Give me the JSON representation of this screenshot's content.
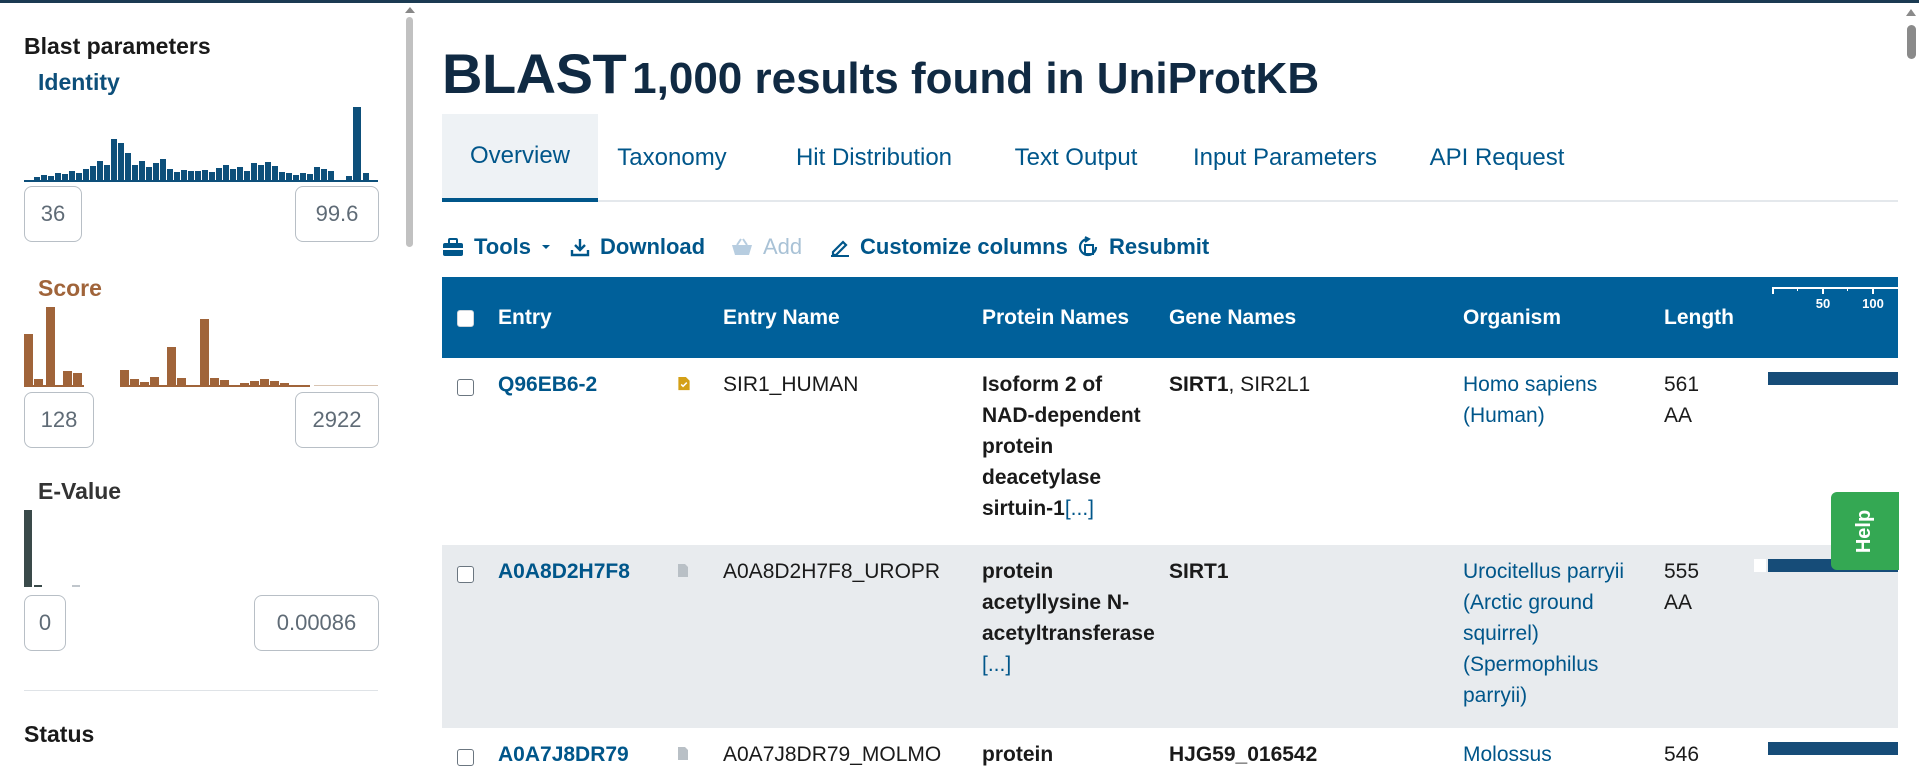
{
  "sidebar": {
    "title": "Blast parameters",
    "identity": {
      "label": "Identity",
      "color": "#0d4f7a",
      "min": "36",
      "max": "99.6"
    },
    "score": {
      "label": "Score",
      "color": "#a0643a",
      "min": "128",
      "max": "2922"
    },
    "evalue": {
      "label": "E-Value",
      "color": "#3a4a4a",
      "min": "0",
      "max": "0.00086"
    },
    "status_label": "Status"
  },
  "header": {
    "title_main": "BLAST",
    "title_sub": "1,000 results found in UniProtKB"
  },
  "tabs": [
    {
      "label": "Overview",
      "active": true
    },
    {
      "label": "Taxonomy"
    },
    {
      "label": "Hit Distribution"
    },
    {
      "label": "Text Output"
    },
    {
      "label": "Input Parameters"
    },
    {
      "label": "API Request"
    }
  ],
  "toolbar": {
    "tools": "Tools",
    "download": "Download",
    "add": "Add",
    "customize": "Customize columns",
    "resubmit": "Resubmit"
  },
  "table": {
    "columns": [
      "Entry",
      "Entry Name",
      "Protein Names",
      "Gene Names",
      "Organism",
      "Length"
    ],
    "scale_ticks": [
      "50",
      "100"
    ],
    "more_link": "[...]",
    "rows": [
      {
        "entry": "Q96EB6-2",
        "entry_name": "SIR1_HUMAN",
        "protein_lines": [
          "Isoform 2 of",
          "NAD-dependent",
          "protein",
          "deacetylase",
          "sirtuin-1"
        ],
        "gene_primary": "SIRT1",
        "gene_rest": ", SIR2L1",
        "organism_lines": [
          "Homo sapiens",
          "(Human)"
        ],
        "length_lines": [
          "561",
          "AA"
        ],
        "reviewed": true
      },
      {
        "entry": "A0A8D2H7F8",
        "entry_name": "A0A8D2H7F8_UROPR",
        "protein_lines": [
          "protein",
          "acetyllysine N-",
          "acetyltransferase"
        ],
        "gene_primary": "SIRT1",
        "gene_rest": "",
        "organism_lines": [
          "Urocitellus parryii",
          "(Arctic ground",
          "squirrel)",
          "(Spermophilus",
          "parryii)"
        ],
        "length_lines": [
          "555",
          "AA"
        ],
        "reviewed": false
      },
      {
        "entry": "A0A7J8DR79",
        "entry_name": "A0A7J8DR79_MOLMO",
        "protein_lines": [
          "protein"
        ],
        "gene_primary": "HJG59_016542",
        "gene_rest": "",
        "organism_lines": [
          "Molossus"
        ],
        "length_lines": [
          "546"
        ],
        "reviewed": false
      }
    ]
  },
  "help_label": "Help"
}
